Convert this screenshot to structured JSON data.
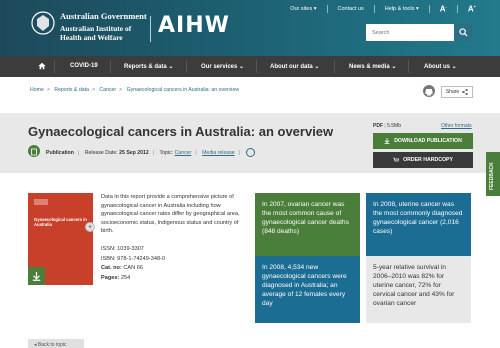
{
  "header": {
    "gov_line1": "Australian Government",
    "gov_line2": "Australian Institute of",
    "gov_line3": "Health and Welfare",
    "brand": "AIHW",
    "utility": [
      "Our sites",
      "Contact us",
      "Help & tools"
    ],
    "text_size_small": "A",
    "text_size_large": "A",
    "search_placeholder": "Search"
  },
  "nav": {
    "items": [
      "COVID-19",
      "Reports & data",
      "Our services",
      "About our data",
      "News & media",
      "About us"
    ]
  },
  "breadcrumb": [
    "Home",
    "Reports & data",
    "Cancer",
    "Gynaecological cancers in Australia: an overview"
  ],
  "share_label": "Share",
  "title": "Gynaecological cancers in Australia: an overview",
  "meta": {
    "type": "Publication",
    "release_label": "Release Date:",
    "release_date": "25 Sep 2012",
    "topic_label": "Topic:",
    "topic": "Cancer",
    "media": "Media release"
  },
  "download": {
    "format": "PDF",
    "size": "5.5Mb",
    "other_formats": "Other formats",
    "download_label": "DOWNLOAD PUBLICATION",
    "order_label": "ORDER HARDCOPY"
  },
  "feedback": "FEEDBACK",
  "cover_title": "Gynaecological cancers in Australia",
  "description": "Data in this report provide a comprehensive picture of gynaecological cancer in Australia including how gynaecological cancer rates differ by geographical area, socioeconomic status, Indigenous status and country of birth.",
  "facts": {
    "issn": "ISSN: 1039-3307",
    "isbn": "ISBN: 978-1-74249-348-0",
    "cat_label": "Cat. no:",
    "cat_value": "CAN 66",
    "pages_label": "Pages:",
    "pages_value": "254"
  },
  "tiles": [
    "In 2007, ovarian cancer was the most common cause of gynaecological cancer deaths (848 deaths)",
    "In 2008, uterine cancer was the most commonly diagnosed gynaecological cancer (2,016 cases)",
    "In 2008, 4,534 new gynaecological cancers were diagnosed in Australia; an average of 12 females every day",
    "5-year relative survival in 2006–2010 was 82% for uterine cancer, 72% for cervical cancer and 43% for ovarian cancer"
  ],
  "back_to_topic": "Back to topic"
}
